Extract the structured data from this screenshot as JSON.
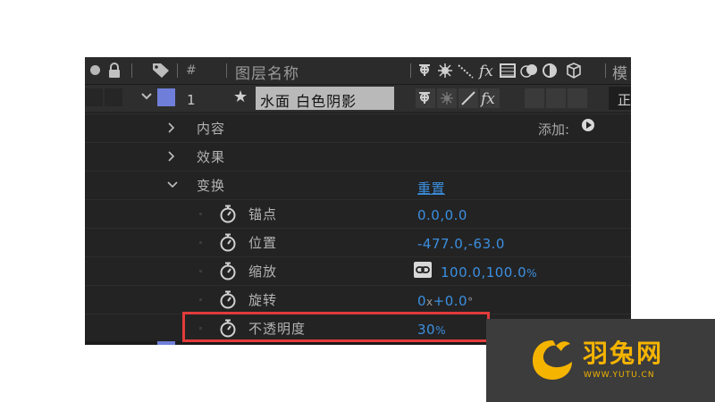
{
  "header": {
    "hash_label": "#",
    "layer_name_label": "图层名称",
    "mode_label": "模"
  },
  "layer": {
    "number": "1",
    "name": "水面 白色阴影",
    "mode_value": "正",
    "label_color": "#6f7fd9"
  },
  "properties": {
    "contents": {
      "label": "内容",
      "add_label": "添加:"
    },
    "effects": {
      "label": "效果"
    },
    "transform": {
      "label": "变换",
      "reset_label": "重置"
    },
    "anchor_point": {
      "label": "锚点",
      "value": "0.0,0.0"
    },
    "position": {
      "label": "位置",
      "value": "-477.0,-63.0"
    },
    "scale": {
      "label": "缩放",
      "value": "100.0,100.0",
      "unit": "%"
    },
    "rotation": {
      "label": "旋转",
      "turns": "0",
      "turns_unit": "x",
      "degrees": "+0.0",
      "degrees_unit": "°"
    },
    "opacity": {
      "label": "不透明度",
      "value": "30",
      "unit": "%"
    }
  },
  "watermark": {
    "brand": "羽兔网",
    "url": "WWW.YUTU.CN"
  },
  "colors": {
    "value_blue": "#3b8fe0",
    "highlight_red": "#e33b3b",
    "brand_yellow": "#f5b400"
  }
}
